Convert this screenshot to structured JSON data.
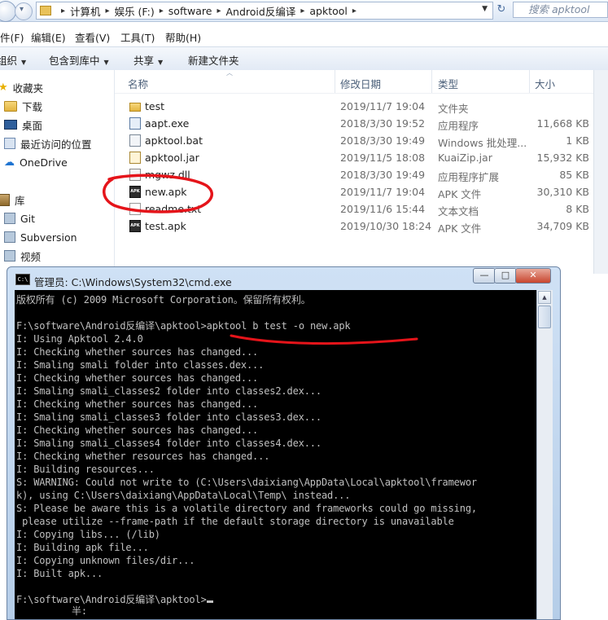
{
  "explorer": {
    "breadcrumbs": [
      "计算机",
      "娱乐 (F:)",
      "software",
      "Android反编译",
      "apktool"
    ],
    "search_placeholder": "搜索 apktool",
    "menu": [
      "件(F)",
      "编辑(E)",
      "查看(V)",
      "工具(T)",
      "帮助(H)"
    ],
    "toolbar": [
      "组织",
      "包含到库中",
      "共享",
      "新建文件夹"
    ],
    "nav": [
      {
        "label": "收藏夹",
        "icon": "star-icon"
      },
      {
        "label": "下载",
        "icon": "folder-icon"
      },
      {
        "label": "桌面",
        "icon": "desktop-icon"
      },
      {
        "label": "最近访问的位置",
        "icon": "recent-places-icon"
      },
      {
        "label": "OneDrive",
        "icon": "cloud-icon"
      },
      {
        "label": "库",
        "icon": "library-icon"
      },
      {
        "label": "Git",
        "icon": "folder-icon"
      },
      {
        "label": "Subversion",
        "icon": "folder-icon"
      },
      {
        "label": "视频",
        "icon": "video-icon"
      }
    ],
    "columns": [
      "名称",
      "修改日期",
      "类型",
      "大小"
    ],
    "files": [
      {
        "name": "test",
        "date": "2019/11/7 19:04",
        "type": "文件夹",
        "size": "",
        "icon": "folder-icon"
      },
      {
        "name": "aapt.exe",
        "date": "2018/3/30 19:52",
        "type": "应用程序",
        "size": "11,668 KB",
        "icon": "exe-icon"
      },
      {
        "name": "apktool.bat",
        "date": "2018/3/30 19:49",
        "type": "Windows 批处理...",
        "size": "1 KB",
        "icon": "bat-icon"
      },
      {
        "name": "apktool.jar",
        "date": "2019/11/5 18:08",
        "type": "KuaiZip.jar",
        "size": "15,932 KB",
        "icon": "jar-icon"
      },
      {
        "name": "mgwz.dll",
        "date": "2018/3/30 19:49",
        "type": "应用程序扩展",
        "size": "85 KB",
        "icon": "dll-icon"
      },
      {
        "name": "new.apk",
        "date": "2019/11/7 19:04",
        "type": "APK 文件",
        "size": "30,310 KB",
        "icon": "apk-icon"
      },
      {
        "name": "readme.txt",
        "date": "2019/11/6 15:44",
        "type": "文本文档",
        "size": "8 KB",
        "icon": "txt-icon"
      },
      {
        "name": "test.apk",
        "date": "2019/10/30 18:24",
        "type": "APK 文件",
        "size": "34,709 KB",
        "icon": "apk-icon"
      }
    ]
  },
  "cmd": {
    "title": "管理员: C:\\Windows\\System32\\cmd.exe",
    "icon_label": "C:\\",
    "buttons": {
      "minimize": "—",
      "maximize": "□",
      "close": "✕"
    },
    "lines": [
      "版权所有 (c) 2009 Microsoft Corporation。保留所有权利。",
      "",
      "F:\\software\\Android反编译\\apktool>apktool b test -o new.apk",
      "I: Using Apktool 2.4.0",
      "I: Checking whether sources has changed...",
      "I: Smaling smali folder into classes.dex...",
      "I: Checking whether sources has changed...",
      "I: Smaling smali_classes2 folder into classes2.dex...",
      "I: Checking whether sources has changed...",
      "I: Smaling smali_classes3 folder into classes3.dex...",
      "I: Checking whether sources has changed...",
      "I: Smaling smali_classes4 folder into classes4.dex...",
      "I: Checking whether resources has changed...",
      "I: Building resources...",
      "S: WARNING: Could not write to (C:\\Users\\daixiang\\AppData\\Local\\apktool\\framewor",
      "k), using C:\\Users\\daixiang\\AppData\\Local\\Temp\\ instead...",
      "S: Please be aware this is a volatile directory and frameworks could go missing,",
      " please utilize --frame-path if the default storage directory is unavailable",
      "I: Copying libs... (/lib)",
      "I: Building apk file...",
      "I: Copying unknown files/dir...",
      "I: Built apk...",
      "",
      "F:\\software\\Android反编译\\apktool>"
    ],
    "ime_fragment": "半:"
  },
  "colors": {
    "annotation": "#e5141a",
    "console_bg": "#000000",
    "console_text": "#c0c0c0"
  }
}
